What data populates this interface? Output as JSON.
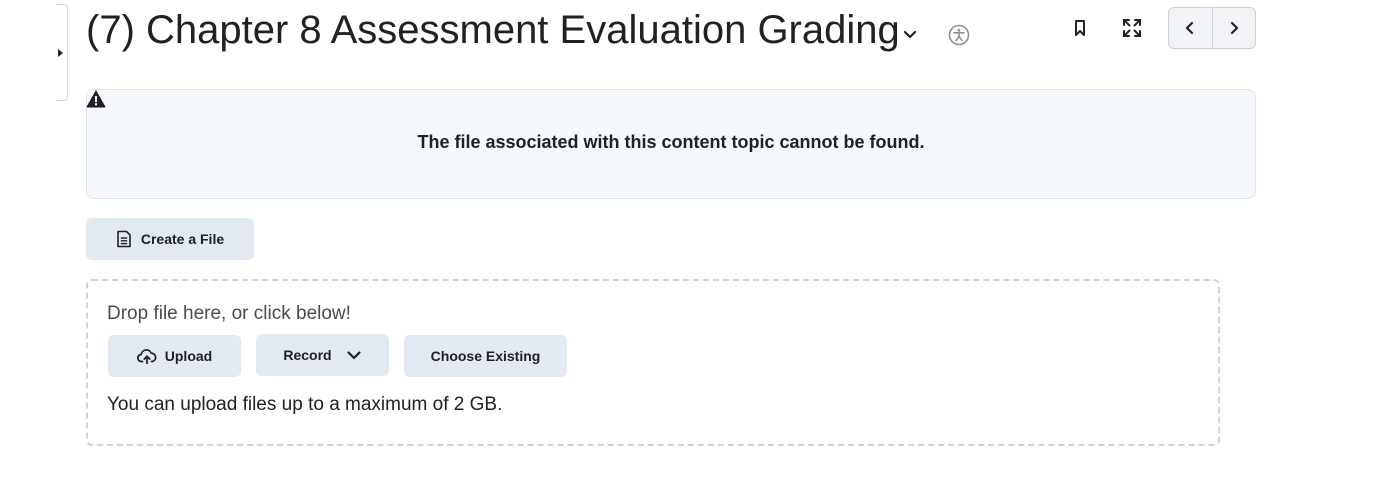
{
  "header": {
    "title": "(7) Chapter 8 Assessment Evaluation Grading",
    "icons": {
      "title_dropdown": "chevron-down-icon",
      "accessibility": "accessibility-icon",
      "bookmark": "bookmark-icon",
      "fullscreen": "fullscreen-icon",
      "previous": "chevron-left-icon",
      "next": "chevron-right-icon",
      "side_panel": "caret-right-icon"
    }
  },
  "alert": {
    "icon": "warning-icon",
    "message": "The file associated with this content topic cannot be found."
  },
  "actions": {
    "create_file_label": "Create a File",
    "create_file_icon": "document-icon"
  },
  "dropzone": {
    "prompt": "Drop file here, or click below!",
    "upload_label": "Upload",
    "upload_icon": "cloud-upload-icon",
    "record_label": "Record",
    "record_icon": "chevron-down-icon",
    "choose_existing_label": "Choose Existing",
    "limit_text": "You can upload files up to a maximum of 2 GB."
  },
  "colors": {
    "text": "#202122",
    "muted_text": "#494c4e",
    "button_bg": "#e3e9f1",
    "alert_bg": "#f5f8fc",
    "border": "#cdd5dc"
  }
}
